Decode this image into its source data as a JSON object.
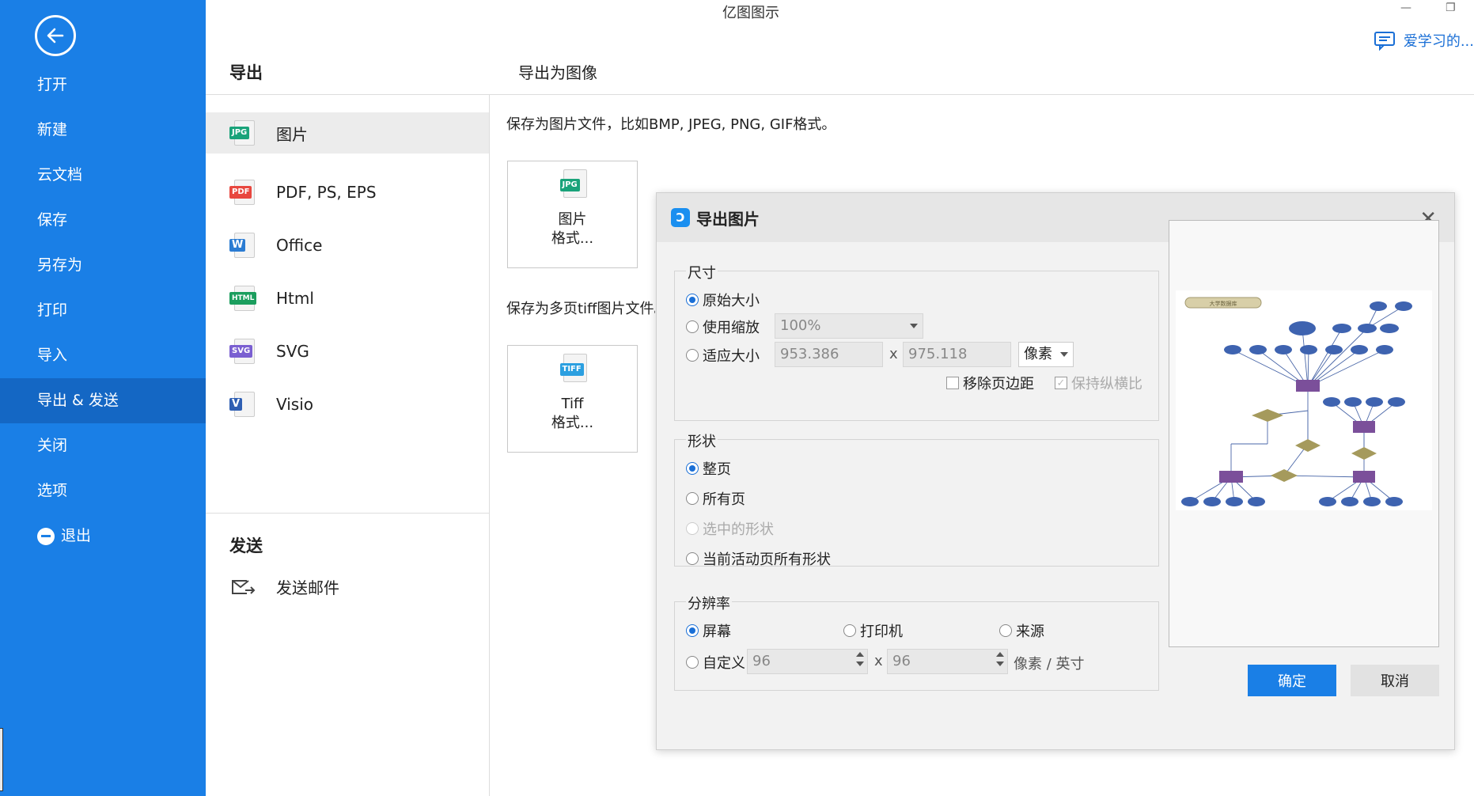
{
  "app_title": "亿图图示",
  "feedback_label": "爱学习的...",
  "sidebar": {
    "items": [
      {
        "label": "打开"
      },
      {
        "label": "新建"
      },
      {
        "label": "云文档"
      },
      {
        "label": "保存"
      },
      {
        "label": "另存为"
      },
      {
        "label": "打印"
      },
      {
        "label": "导入"
      },
      {
        "label": "导出 & 发送"
      },
      {
        "label": "关闭"
      },
      {
        "label": "选项"
      },
      {
        "label": "退出"
      }
    ]
  },
  "export": {
    "header": "导出",
    "formats": [
      {
        "label": "图片",
        "tag": "JPG",
        "color": "#1aa37a"
      },
      {
        "label": "PDF, PS, EPS",
        "tag": "PDF",
        "color": "#e8473f"
      },
      {
        "label": "Office",
        "tag": "W",
        "color": "#2b7cd3"
      },
      {
        "label": "Html",
        "tag": "HTML",
        "color": "#1b9e5e"
      },
      {
        "label": "SVG",
        "tag": "SVG",
        "color": "#7a5fd1"
      },
      {
        "label": "Visio",
        "tag": "V",
        "color": "#2f5fb3"
      }
    ]
  },
  "send": {
    "header": "发送",
    "email_label": "发送邮件"
  },
  "right_panel": {
    "header": "导出为图像",
    "desc_image": "保存为图片文件，比如BMP, JPEG, PNG, GIF格式。",
    "btn_image_line1": "图片",
    "btn_image_line2": "格式...",
    "desc_tiff": "保存为多页tiff图片文件。",
    "btn_tiff_line1": "Tiff",
    "btn_tiff_line2": "格式...",
    "tag_jpg": "JPG",
    "tag_tiff": "TIFF"
  },
  "dialog": {
    "title": "导出图片",
    "size_group": "尺寸",
    "original_size": "原始大小",
    "use_zoom": "使用缩放",
    "zoom_value": "100%",
    "fit_size": "适应大小",
    "width_value": "953.386",
    "height_value": "975.118",
    "x_sep": "x",
    "unit": "像素",
    "remove_margin": "移除页边距",
    "keep_ratio": "保持纵横比",
    "shape_group": "形状",
    "whole_page": "整页",
    "all_pages": "所有页",
    "selected_shapes": "选中的形状",
    "current_page_all": "当前活动页所有形状",
    "res_group": "分辨率",
    "screen": "屏幕",
    "printer": "打印机",
    "source": "来源",
    "custom": "自定义",
    "dpi_x": "96",
    "dpi_y": "96",
    "dpi_unit": "像素 / 英寸",
    "ok": "确定",
    "cancel": "取消",
    "preview_title": "大学数据库"
  }
}
